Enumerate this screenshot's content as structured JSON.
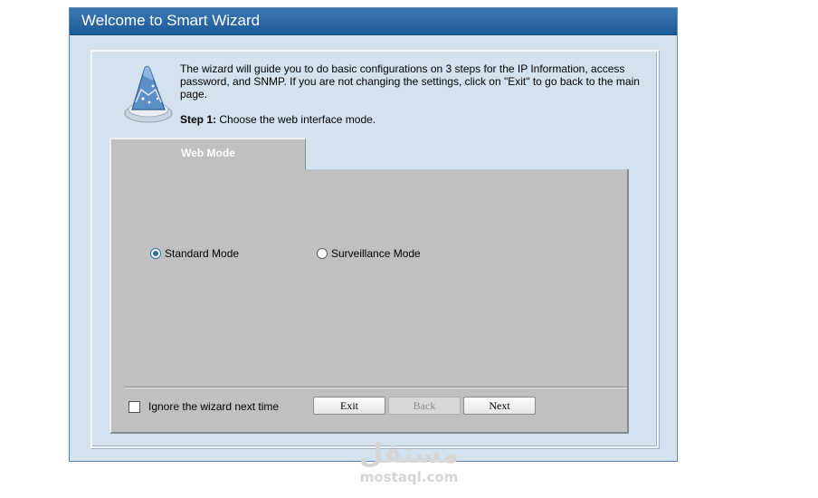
{
  "window": {
    "title": "Welcome to Smart Wizard"
  },
  "intro": {
    "text": "The wizard will guide you to do basic configurations on 3 steps for the IP Information, access password, and SNMP. If you are not changing the settings, click on \"Exit\" to go back to the main page.",
    "step_label": "Step 1:",
    "step_text": " Choose the web interface mode."
  },
  "tab": {
    "label": "Web Mode"
  },
  "modes": {
    "standard_label": "Standard Mode",
    "standard_checked": true,
    "surveillance_label": "Surveillance Mode",
    "surveillance_checked": false
  },
  "footer": {
    "ignore_label": "Ignore the wizard next time",
    "ignore_checked": false,
    "exit_label": "Exit",
    "back_label": "Back",
    "back_enabled": false,
    "next_label": "Next"
  },
  "watermark": {
    "arabic": "مستقل",
    "latin": "mostaql.com"
  },
  "colors": {
    "title_bar": "#2a6aa8",
    "background": "#d2e2ee",
    "tab_panel": "#c0c0c0",
    "radio_accent": "#2b6fb8"
  },
  "icons": {
    "wizard": "wizard-hat-icon"
  }
}
